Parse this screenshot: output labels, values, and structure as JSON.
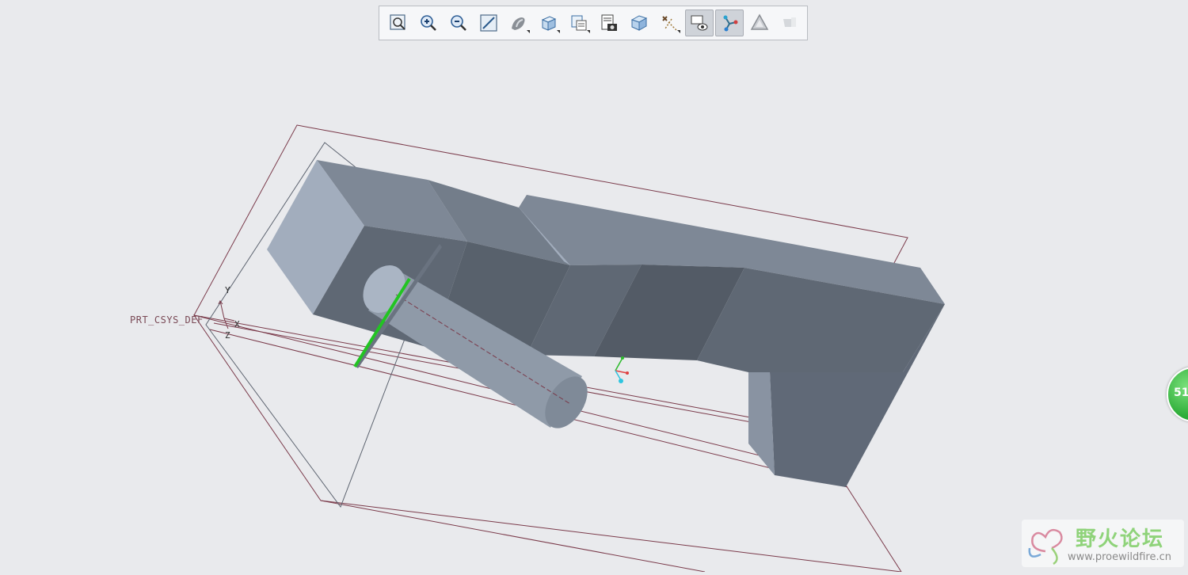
{
  "toolbar": {
    "buttons": [
      {
        "name": "refit-button",
        "icon": "refit-icon",
        "active": false
      },
      {
        "name": "zoom-in-button",
        "icon": "zoom-in-icon",
        "active": false
      },
      {
        "name": "zoom-out-button",
        "icon": "zoom-out-icon",
        "active": false
      },
      {
        "name": "repaint-button",
        "icon": "repaint-icon",
        "active": false
      },
      {
        "name": "display-style-button",
        "icon": "shading-icon",
        "active": false,
        "dropdown": true
      },
      {
        "name": "saved-orientations-button",
        "icon": "cube-view-icon",
        "active": false,
        "dropdown": true
      },
      {
        "name": "named-views-button",
        "icon": "view-manager-icon",
        "active": false,
        "dropdown": true
      },
      {
        "name": "view-manager-button",
        "icon": "layer-camera-icon",
        "active": false
      },
      {
        "name": "perspective-view-button",
        "icon": "perspective-cube-icon",
        "active": false
      },
      {
        "name": "datum-display-button",
        "icon": "datum-display-icon",
        "active": false,
        "dropdown": true
      },
      {
        "name": "annotation-display-button",
        "icon": "annotation-eye-icon",
        "active": true
      },
      {
        "name": "spin-center-button",
        "icon": "spin-center-icon",
        "active": true
      },
      {
        "name": "appearance-button",
        "icon": "warning-triangle-icon",
        "active": false
      },
      {
        "name": "section-button",
        "icon": "section-icon",
        "active": false
      }
    ]
  },
  "viewport": {
    "csys_label": "PRT_CSYS_DEF",
    "axis_x": "X",
    "axis_y": "Y",
    "axis_z": "Z"
  },
  "badge": {
    "text": "51"
  },
  "watermark": {
    "title": "野火论坛",
    "url": "www.proewildfire.cn"
  },
  "colors": {
    "background": "#e9eaed",
    "datum_line": "#7a3a4a",
    "part_top": "#7e8896",
    "part_front": "#5f6874",
    "part_light": "#a2adbd",
    "highlight": "#22c422"
  }
}
